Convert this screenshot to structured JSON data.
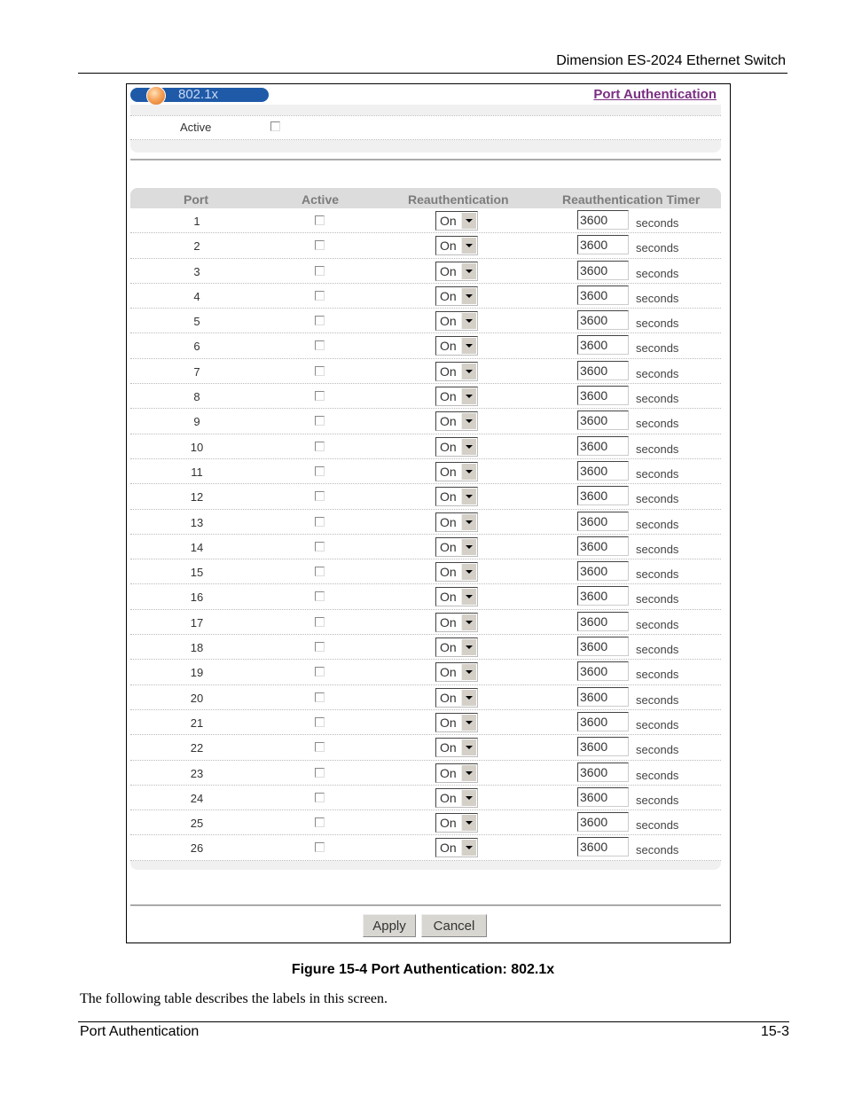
{
  "page_header": {
    "title": "Dimension ES-2024 Ethernet Switch"
  },
  "screen": {
    "tab_title": "802.1x",
    "link_label": "Port Authentication",
    "active_label": "Active",
    "active_checked": false,
    "table": {
      "headers": [
        "Port",
        "Active",
        "Reauthentication",
        "Reauthentication Timer"
      ],
      "rows": [
        {
          "port": "1",
          "active": false,
          "reauth": "On",
          "timer": "3600",
          "unit": "seconds"
        },
        {
          "port": "2",
          "active": false,
          "reauth": "On",
          "timer": "3600",
          "unit": "seconds"
        },
        {
          "port": "3",
          "active": false,
          "reauth": "On",
          "timer": "3600",
          "unit": "seconds"
        },
        {
          "port": "4",
          "active": false,
          "reauth": "On",
          "timer": "3600",
          "unit": "seconds"
        },
        {
          "port": "5",
          "active": false,
          "reauth": "On",
          "timer": "3600",
          "unit": "seconds"
        },
        {
          "port": "6",
          "active": false,
          "reauth": "On",
          "timer": "3600",
          "unit": "seconds"
        },
        {
          "port": "7",
          "active": false,
          "reauth": "On",
          "timer": "3600",
          "unit": "seconds"
        },
        {
          "port": "8",
          "active": false,
          "reauth": "On",
          "timer": "3600",
          "unit": "seconds"
        },
        {
          "port": "9",
          "active": false,
          "reauth": "On",
          "timer": "3600",
          "unit": "seconds"
        },
        {
          "port": "10",
          "active": false,
          "reauth": "On",
          "timer": "3600",
          "unit": "seconds"
        },
        {
          "port": "11",
          "active": false,
          "reauth": "On",
          "timer": "3600",
          "unit": "seconds"
        },
        {
          "port": "12",
          "active": false,
          "reauth": "On",
          "timer": "3600",
          "unit": "seconds"
        },
        {
          "port": "13",
          "active": false,
          "reauth": "On",
          "timer": "3600",
          "unit": "seconds"
        },
        {
          "port": "14",
          "active": false,
          "reauth": "On",
          "timer": "3600",
          "unit": "seconds"
        },
        {
          "port": "15",
          "active": false,
          "reauth": "On",
          "timer": "3600",
          "unit": "seconds"
        },
        {
          "port": "16",
          "active": false,
          "reauth": "On",
          "timer": "3600",
          "unit": "seconds"
        },
        {
          "port": "17",
          "active": false,
          "reauth": "On",
          "timer": "3600",
          "unit": "seconds"
        },
        {
          "port": "18",
          "active": false,
          "reauth": "On",
          "timer": "3600",
          "unit": "seconds"
        },
        {
          "port": "19",
          "active": false,
          "reauth": "On",
          "timer": "3600",
          "unit": "seconds"
        },
        {
          "port": "20",
          "active": false,
          "reauth": "On",
          "timer": "3600",
          "unit": "seconds"
        },
        {
          "port": "21",
          "active": false,
          "reauth": "On",
          "timer": "3600",
          "unit": "seconds"
        },
        {
          "port": "22",
          "active": false,
          "reauth": "On",
          "timer": "3600",
          "unit": "seconds"
        },
        {
          "port": "23",
          "active": false,
          "reauth": "On",
          "timer": "3600",
          "unit": "seconds"
        },
        {
          "port": "24",
          "active": false,
          "reauth": "On",
          "timer": "3600",
          "unit": "seconds"
        },
        {
          "port": "25",
          "active": false,
          "reauth": "On",
          "timer": "3600",
          "unit": "seconds"
        },
        {
          "port": "26",
          "active": false,
          "reauth": "On",
          "timer": "3600",
          "unit": "seconds"
        }
      ]
    },
    "buttons": {
      "apply": "Apply",
      "cancel": "Cancel"
    },
    "colors": {
      "title_bar": "#1f5aa8",
      "link": "#7b2f82",
      "header_bg": "#dcdcdc"
    }
  },
  "caption": "Figure 15-4 Port Authentication: 802.1x",
  "body_text": "The following table describes the labels in this screen.",
  "footer": {
    "left": "Port Authentication",
    "right": "15-3"
  }
}
